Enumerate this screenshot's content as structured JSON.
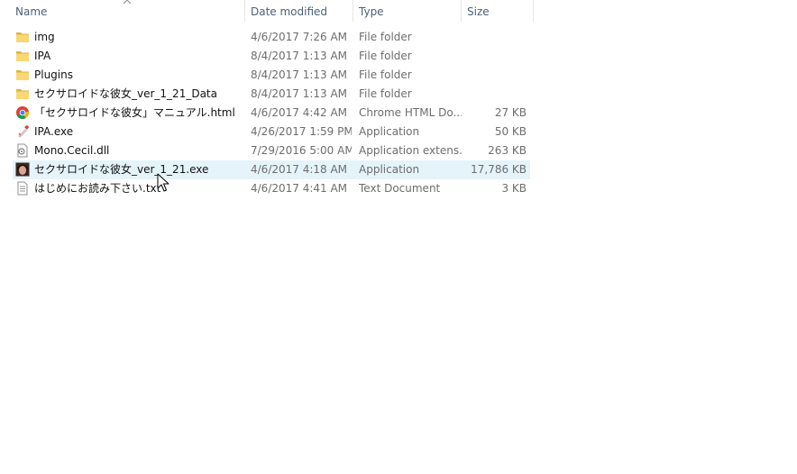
{
  "columns": {
    "name": "Name",
    "date": "Date modified",
    "type": "Type",
    "size": "Size"
  },
  "files": [
    {
      "name": "img",
      "date": "4/6/2017 7:26 AM",
      "type": "File folder",
      "size": "",
      "icon": "folder-icon"
    },
    {
      "name": "IPA",
      "date": "8/4/2017 1:13 AM",
      "type": "File folder",
      "size": "",
      "icon": "folder-icon"
    },
    {
      "name": "Plugins",
      "date": "8/4/2017 1:13 AM",
      "type": "File folder",
      "size": "",
      "icon": "folder-icon"
    },
    {
      "name": "セクサロイドな彼女_ver_1_21_Data",
      "date": "8/4/2017 1:13 AM",
      "type": "File folder",
      "size": "",
      "icon": "folder-icon"
    },
    {
      "name": "「セクサロイドな彼女」マニュアル.html",
      "date": "4/6/2017 4:42 AM",
      "type": "Chrome HTML Do...",
      "size": "27 KB",
      "icon": "chrome-icon"
    },
    {
      "name": "IPA.exe",
      "date": "4/26/2017 1:59 PM",
      "type": "Application",
      "size": "50 KB",
      "icon": "ipa-app-icon"
    },
    {
      "name": "Mono.Cecil.dll",
      "date": "7/29/2016 5:00 AM",
      "type": "Application extens...",
      "size": "263 KB",
      "icon": "dll-icon"
    },
    {
      "name": "セクサロイドな彼女_ver_1_21.exe",
      "date": "4/6/2017 4:18 AM",
      "type": "Application",
      "size": "17,786 KB",
      "icon": "game-app-icon"
    },
    {
      "name": "はじめにお読み下さい.txt",
      "date": "4/6/2017 4:41 AM",
      "type": "Text Document",
      "size": "3 KB",
      "icon": "text-file-icon"
    }
  ],
  "selected_index": 7,
  "colors": {
    "header_text": "#4c607a",
    "secondary_text": "#6d6d6d",
    "selection": "#e5f3fb",
    "folder": "#f8d775"
  }
}
